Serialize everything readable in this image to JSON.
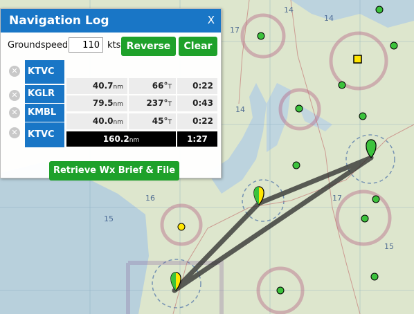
{
  "panel": {
    "title": "Navigation Log",
    "close_label": "X",
    "groundspeed_label": "Groundspeed",
    "groundspeed_value": "110",
    "groundspeed_unit": "kts",
    "reverse_label": "Reverse",
    "clear_label": "Clear",
    "retrieve_label": "Retrieve Wx Brief & File",
    "waypoints": [
      {
        "id": "KTVC"
      },
      {
        "id": "KGLR",
        "distance": "40.7",
        "dist_unit": "nm",
        "heading": "66°",
        "hdg_unit": "T",
        "time": "0:22"
      },
      {
        "id": "KMBL",
        "distance": "79.5",
        "dist_unit": "nm",
        "heading": "237°",
        "hdg_unit": "T",
        "time": "0:43"
      },
      {
        "id": "KTVC",
        "distance": "40.0",
        "dist_unit": "nm",
        "heading": "45°",
        "hdg_unit": "T",
        "time": "0:22"
      }
    ],
    "total": {
      "distance": "160.2",
      "dist_unit": "nm",
      "time": "1:27"
    }
  },
  "map": {
    "route_color": "#2b2b2b",
    "map_bg": "#dfe8d2",
    "water_color": "#b8d2e0",
    "airport_green": "#3cc23c",
    "airport_yellow": "#ffe600"
  }
}
